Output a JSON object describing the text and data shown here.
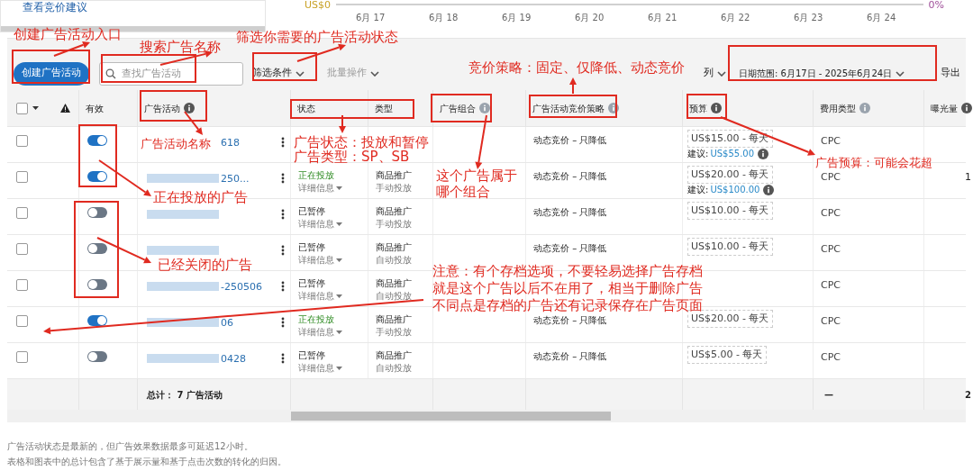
{
  "top_panel": {
    "link": "查看竞价建议"
  },
  "chart": {
    "y_label": "US$0",
    "y2_label": "0%",
    "x_labels": [
      "6月 17",
      "6月 18",
      "6月 19",
      "6月 20",
      "6月 21",
      "6月 22",
      "6月 23",
      "6月 24"
    ]
  },
  "toolbar": {
    "create_button": "创建广告活动",
    "search": {
      "placeholder": "查找广告活动"
    },
    "filter": "筛选条件",
    "bulk": {
      "label": "批量操作",
      "disabled": true
    },
    "columns": "列",
    "date_range": "日期范围: 6月17日 - 2025年6月24日",
    "export": "导出"
  },
  "table": {
    "select_all": {
      "checked": false
    },
    "columns": [
      {
        "label": "有效"
      },
      {
        "label": "广告活动",
        "info_icon": true,
        "info_dark": true
      },
      {
        "label": "状态"
      },
      {
        "label": "类型"
      },
      {
        "label": "广告组合",
        "info_icon": true,
        "info_dark": false
      },
      {
        "label": "广告活动竞价策略",
        "info_icon": true,
        "info_dark": false
      },
      {
        "label": "预算",
        "info_icon": true,
        "info_dark": true
      },
      {
        "label": "费用类型",
        "info_icon": true,
        "info_dark": false
      },
      {
        "label": "曝光量",
        "info_icon": true,
        "info_dark": true
      }
    ],
    "rows": [
      {
        "checked": false,
        "enabled": true,
        "redacted": false,
        "name": "618",
        "strategy": "动态竞价 – 只降低",
        "budget": "US$15.00 - 每天",
        "suggestion": {
          "label": "建议:",
          "amount": "US$55.00"
        },
        "cost_type": "CPC"
      },
      {
        "checked": false,
        "enabled": true,
        "name": "250...",
        "status": {
          "label": "正在投放",
          "kind": "active",
          "details": "详细信息"
        },
        "type": {
          "label": "商品推广",
          "targeting": "手动投放"
        },
        "strategy": "动态竞价 – 只降低",
        "budget": "US$20.00 - 每天",
        "suggestion": {
          "label": "建议:",
          "amount": "US$100.00"
        },
        "cost_type": "CPC",
        "impressions": "1"
      },
      {
        "checked": false,
        "enabled": false,
        "status": {
          "label": "已暂停",
          "kind": "paused",
          "details": "详细信息"
        },
        "type": {
          "label": "商品推广",
          "targeting": "手动投放"
        },
        "strategy": "动态竞价 – 只降低",
        "budget": "US$10.00 - 每天",
        "cost_type": "CPC"
      },
      {
        "checked": false,
        "enabled": false,
        "status": {
          "label": "已暂停",
          "kind": "paused",
          "details": "详细信息"
        },
        "type": {
          "label": "商品推广",
          "targeting": "自动投放"
        },
        "strategy": "动态竞价 – 只降低",
        "budget": "US$10.00 - 每天",
        "cost_type": "CPC"
      },
      {
        "checked": false,
        "enabled": false,
        "name": "-250506",
        "status": {
          "label": "已暂停",
          "kind": "paused",
          "details": "详细信息"
        },
        "type": {
          "label": "商品推广",
          "targeting": "自动投放"
        },
        "cost_type": "CPC"
      },
      {
        "checked": false,
        "enabled": true,
        "name": "06",
        "status": {
          "label": "正在投放",
          "kind": "active",
          "details": "详细信息"
        },
        "type": {
          "label": "商品推广",
          "targeting": "手动投放"
        },
        "strategy": "动态竞价 – 只降低",
        "budget": "US$20.00 - 每天",
        "cost_type": "CPC"
      },
      {
        "checked": false,
        "enabled": false,
        "name": "0428",
        "status": {
          "label": "已暂停",
          "kind": "paused",
          "details": "详细信息"
        },
        "type": {
          "label": "商品推广",
          "targeting": "自动投放"
        },
        "strategy": "动态竞价 – 只降低",
        "budget": "US$5.00 - 每天",
        "cost_type": "CPC"
      }
    ],
    "total": {
      "label": "总计： 7 广告活动",
      "cost_type": "—",
      "impressions": "2"
    }
  },
  "footnotes": [
    "广告活动状态是最新的，但广告效果数据最多可延迟12小时。",
    "表格和图表中的总计包含了基于展示量和基于点击次数的转化的归因。"
  ],
  "annotations": [
    "创建广告活动入口",
    "搜索广告名称",
    "筛选你需要的广告活动状态",
    "竞价策略：固定、仅降低、动态竞价",
    "广告活动名称",
    "广告状态：投放和暂停",
    "广告类型：SP、SB",
    "这个广告属于哪个组合",
    "广告预算：可能会花超",
    "正在投放的广告",
    "已经关闭的广告",
    "注意：有个存档选项，不要轻易选择广告存档",
    "就是这个广告以后不在用了，相当于删除广告",
    "不同点是存档的广告还有记录保存在广告页面"
  ]
}
